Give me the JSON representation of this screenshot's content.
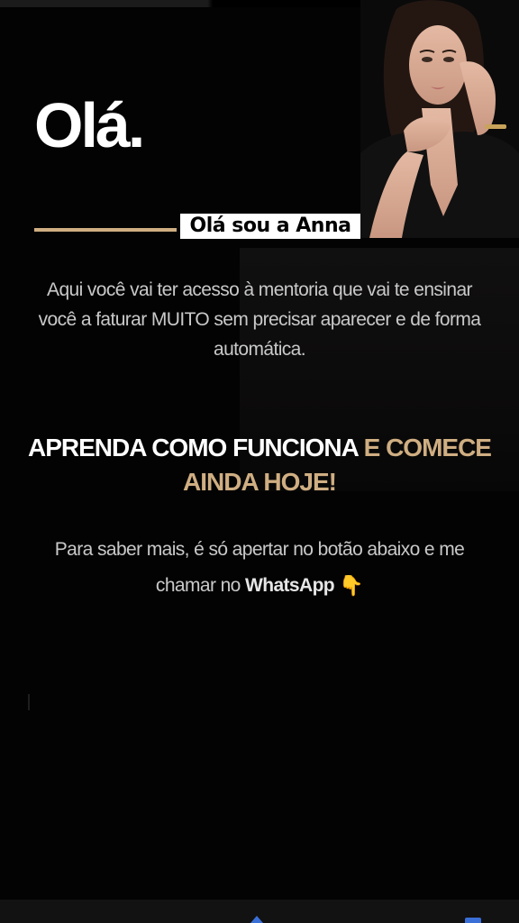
{
  "header": {
    "greeting": "Olá.",
    "intro_label": "Olá sou a Anna"
  },
  "content": {
    "description": "Aqui você vai ter acesso à mentoria que vai te ensinar você a faturar MUITO sem precisar aparecer e de forma automática.",
    "headline_white": "APRENDA COMO FUNCIONA",
    "headline_gold": "E COMECE AINDA HOJE!",
    "cta_prefix": "Para saber mais, é só apertar no botão abaixo e me chamar no",
    "cta_brand": "WhatsApp",
    "cta_emoji": "👇"
  },
  "colors": {
    "background": "#030303",
    "accent_gold": "#cfae82",
    "text_white": "#ffffff",
    "text_gray": "#c9c9c9",
    "nav_blue": "#3a6fd8"
  },
  "icons": {
    "photo": "profile-photo-woman",
    "hand": "pointing-down-hand-icon",
    "nav_up": "chevron-up-icon",
    "nav_tabs": "tabs-icon"
  }
}
